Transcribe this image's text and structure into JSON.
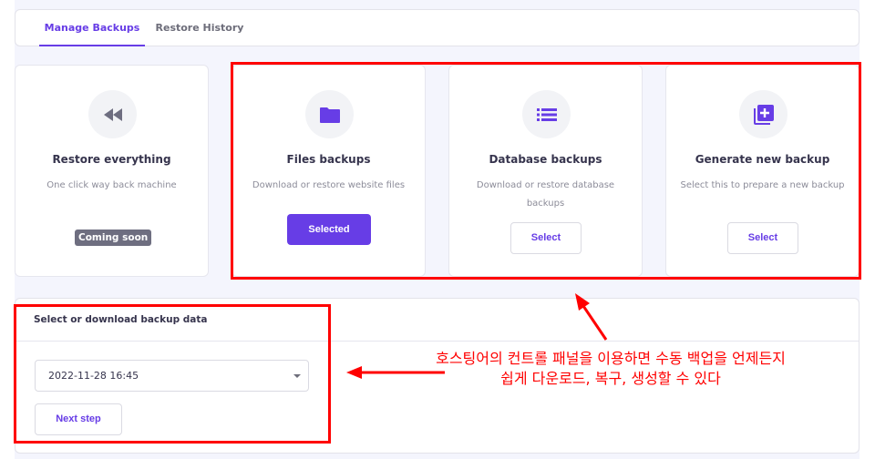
{
  "tabs": [
    {
      "label": "Manage Backups",
      "active": true
    },
    {
      "label": "Restore History",
      "active": false
    }
  ],
  "cards": [
    {
      "icon": "rewind-icon",
      "title": "Restore everything",
      "description": "One click way back machine",
      "badge": "Coming soon"
    },
    {
      "icon": "folder-icon",
      "title": "Files backups",
      "description": "Download or restore website files",
      "button": "Selected"
    },
    {
      "icon": "list-icon",
      "title": "Database backups",
      "description": "Download or restore database backups",
      "button": "Select"
    },
    {
      "icon": "add-library-icon",
      "title": "Generate new backup",
      "description": "Select this to prepare a new backup",
      "button": "Select"
    }
  ],
  "panel": {
    "title": "Select or download backup data",
    "selected_backup": "2022-11-28 16:45",
    "next_label": "Next step"
  },
  "annotation": "호스팅어의 컨트롤 패널을 이용하면 수동 백업을 언제든지 쉽게 다운로드, 복구, 생성할 수 있다",
  "colors": {
    "accent": "#673de6",
    "annotation": "#ff0000"
  }
}
